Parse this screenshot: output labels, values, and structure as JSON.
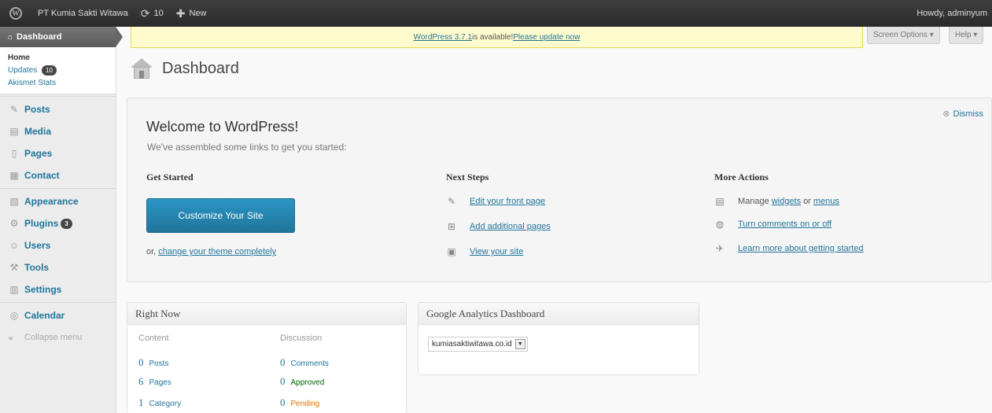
{
  "adminbar": {
    "logo_glyph": "W",
    "site_name": "PT Kumia Sakti Witawa",
    "updates_glyph": "⟳",
    "updates_count": "10",
    "new_glyph": "✚",
    "new_label": "New",
    "howdy": "Howdy, adminyum"
  },
  "sidebar": {
    "current": {
      "glyph": "⌂",
      "label": "Dashboard"
    },
    "submenu": {
      "home": "Home",
      "updates": "Updates",
      "updates_count": "10",
      "akismet": "Akismet Stats"
    },
    "items": [
      {
        "label": "Posts",
        "glyph": "✎"
      },
      {
        "label": "Media",
        "glyph": "▤"
      },
      {
        "label": "Pages",
        "glyph": "▯"
      },
      {
        "label": "Contact",
        "glyph": "▦"
      },
      {
        "label": "Appearance",
        "glyph": "▧"
      },
      {
        "label": "Plugins",
        "glyph": "⚙",
        "count": "3"
      },
      {
        "label": "Users",
        "glyph": "☺"
      },
      {
        "label": "Tools",
        "glyph": "⚒"
      },
      {
        "label": "Settings",
        "glyph": "▥"
      },
      {
        "label": "Calendar",
        "glyph": "◎"
      }
    ],
    "collapse": {
      "glyph": "◂",
      "label": "Collapse menu"
    }
  },
  "nag": {
    "link1": "WordPress 3.7.1",
    "middle": " is available! ",
    "link2": "Please update now"
  },
  "screen_options": "Screen Options ▾",
  "help": "Help ▾",
  "page_title": "Dashboard",
  "welcome": {
    "dismiss_glyph": "⊗",
    "dismiss": "Dismiss",
    "title": "Welcome to WordPress!",
    "about": "We've assembled some links to get you started:",
    "get_started": {
      "heading": "Get Started",
      "button": "Customize Your Site",
      "or": "or, ",
      "change_theme": "change your theme completely"
    },
    "next_steps": {
      "heading": "Next Steps",
      "items": [
        {
          "glyph": "✎",
          "label": "Edit your front page"
        },
        {
          "glyph": "⊞",
          "label": "Add additional pages"
        },
        {
          "glyph": "▣",
          "label": "View your site"
        }
      ]
    },
    "more_actions": {
      "heading": "More Actions",
      "manage_glyph": "▤",
      "manage": "Manage",
      "widgets": "widgets",
      "or": "or",
      "menus": "menus",
      "comments_glyph": "◍",
      "comments": "Turn comments on or off",
      "learn_glyph": "✈",
      "learn": "Learn more about getting started"
    }
  },
  "right_now": {
    "title": "Right Now",
    "content_head": "Content",
    "discussion_head": "Discussion",
    "content": [
      {
        "num": "0",
        "label": "Posts"
      },
      {
        "num": "6",
        "label": "Pages"
      },
      {
        "num": "1",
        "label": "Category"
      }
    ],
    "discussion": [
      {
        "num": "0",
        "label": "Comments"
      },
      {
        "num": "0",
        "label": "Approved"
      },
      {
        "num": "0",
        "label": "Pending"
      }
    ]
  },
  "ga": {
    "title": "Google Analytics Dashboard",
    "selected": "kumiasaktiwitawa.co.id",
    "dd_glyph": "▼"
  }
}
